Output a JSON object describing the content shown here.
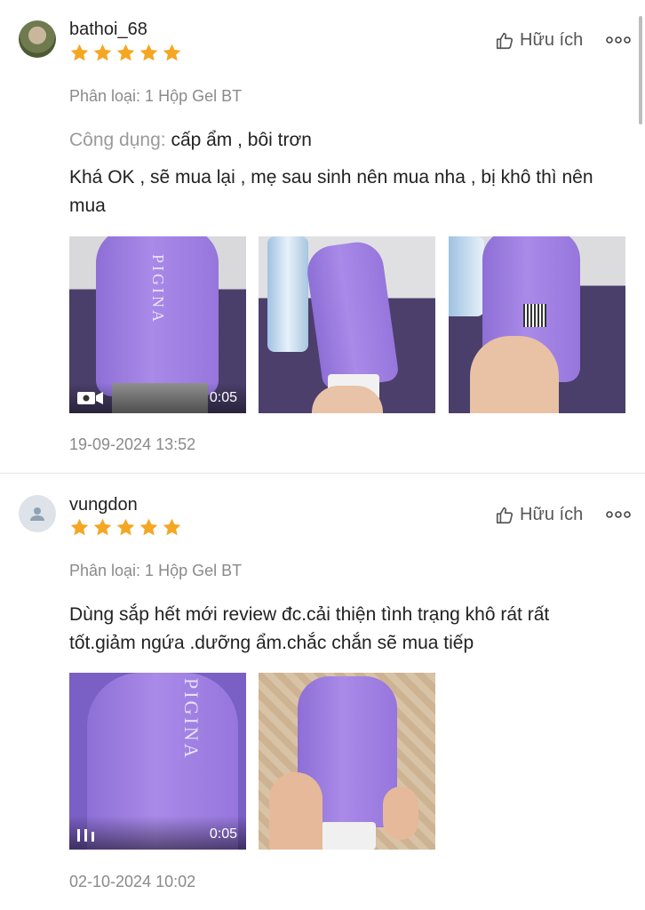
{
  "reviews": [
    {
      "username": "bathoi_68",
      "rating": 5,
      "helpful_label": "Hữu ích",
      "variant": "Phân loại: 1 Hộp Gel BT",
      "usage_label": "Công dụng:",
      "usage_value": "cấp ẩm , bôi trơn",
      "content": "Khá OK , sẽ mua lại , mẹ sau sinh nên mua nha , bị khô thì nên mua",
      "video_duration": "0:05",
      "date": "19-09-2024 13:52"
    },
    {
      "username": "vungdon",
      "rating": 5,
      "helpful_label": "Hữu ích",
      "variant": "Phân loại: 1 Hộp Gel BT",
      "content": "Dùng sắp hết mới review đc.cải thiện tình trạng khô rát rất tốt.giảm ngứa .dưỡng ẩm.chắc chắn sẽ mua tiếp",
      "video_duration": "0:05",
      "date": "02-10-2024 10:02"
    }
  ],
  "product_brand_text": "PIGINA",
  "icons": {
    "star": "star-icon",
    "helpful": "thumbs-up-icon",
    "more": "more-dots-icon",
    "video": "video-camera-icon",
    "pause": "pause-bars-icon",
    "avatar_default": "user-icon"
  },
  "colors": {
    "star": "#f5a623",
    "text": "#222222",
    "muted": "#8a8a8a",
    "product_purple": "#a084e6"
  }
}
